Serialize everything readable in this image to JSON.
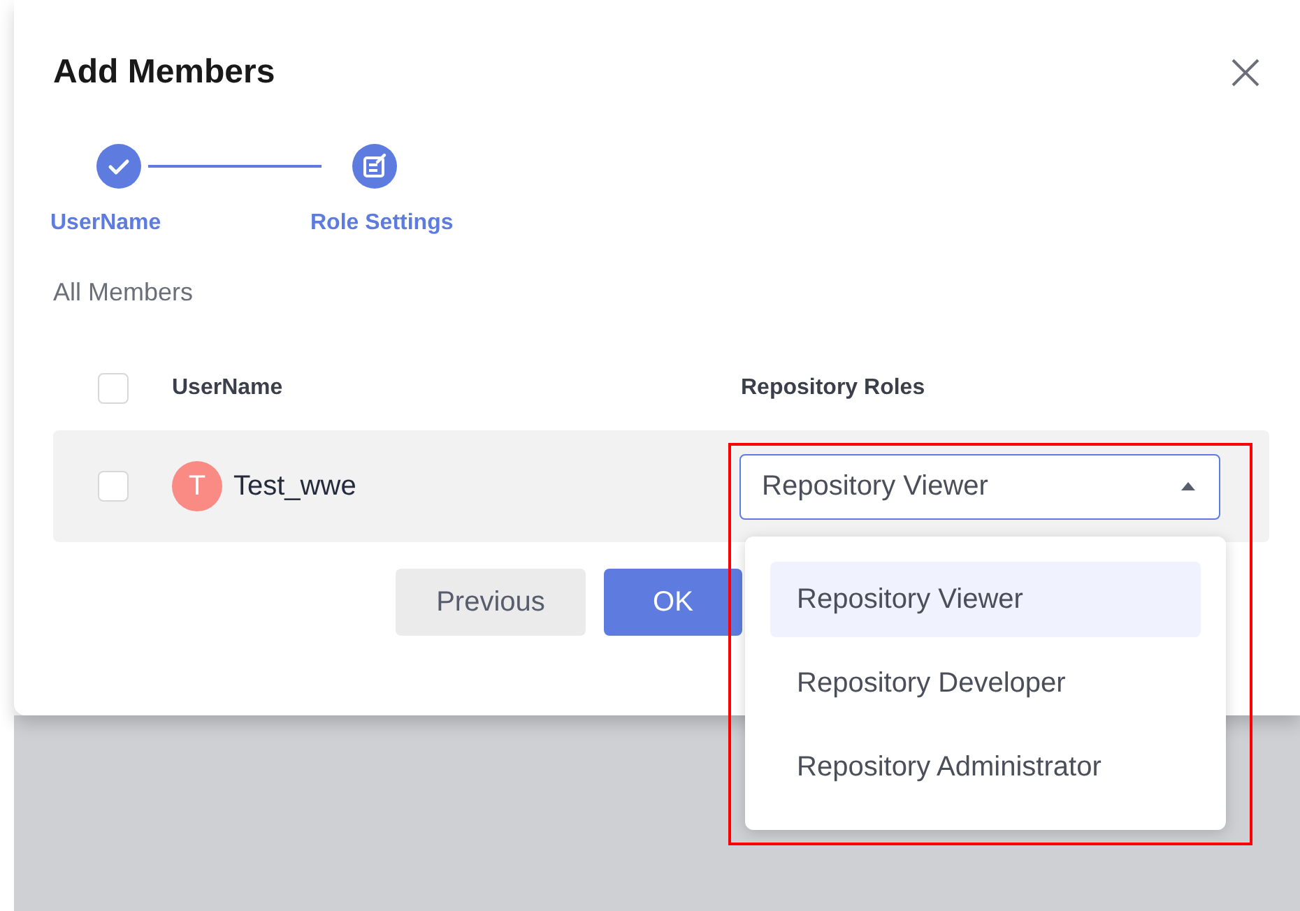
{
  "dialog": {
    "title": "Add Members"
  },
  "steps": [
    {
      "label": "UserName",
      "kind": "done"
    },
    {
      "label": "Role Settings",
      "kind": "current"
    }
  ],
  "section_label": "All Members",
  "table": {
    "header_checked": false,
    "columns": [
      "UserName",
      "Repository Roles"
    ],
    "rows": [
      {
        "checked": false,
        "avatar": "T",
        "color": "#f98a84",
        "name": "Test_wwe",
        "role": "Repository Viewer",
        "expanded": true
      }
    ]
  },
  "dropdown": {
    "options": [
      {
        "label": "Repository Viewer",
        "selected": true
      },
      {
        "label": "Repository Developer",
        "selected": false
      },
      {
        "label": "Repository Administrator",
        "selected": false
      }
    ]
  },
  "buttons": [
    {
      "label": "Previous",
      "kind": "secondary"
    },
    {
      "label": "OK",
      "kind": "primary"
    }
  ],
  "annotation": {
    "kind": "highlight"
  }
}
